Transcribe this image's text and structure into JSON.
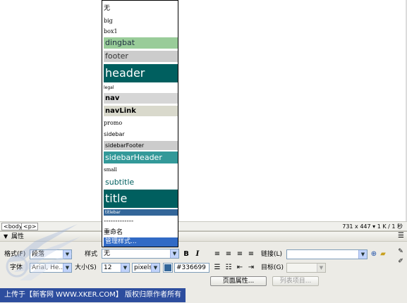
{
  "status_bar": {
    "tags": [
      "<body>",
      "<p>"
    ],
    "size_readout": "731 x 447",
    "download": "1 K / 1 秒"
  },
  "panel": {
    "title": "属性",
    "format_label": "格式(F)",
    "format_value": "段落",
    "font_label": "字体",
    "font_value": "Arial, He...",
    "style_label": "样式",
    "style_value": "无",
    "size_label": "大小(S)",
    "size_value": "12",
    "unit_value": "pixels",
    "color_value": "#336699",
    "bold_label": "B",
    "italic_label": "I",
    "link_label": "链接(L)",
    "link_value": "",
    "target_label": "目标(G)",
    "target_value": "",
    "page_props_button": "页面属性...",
    "list_item_button": "列表项目..."
  },
  "footer": {
    "credit": "上传于【新客网 WWW.XKER.COM】 版权归原作者所有"
  },
  "dropdown": {
    "items": [
      {
        "label": "无"
      },
      {
        "label": "big"
      },
      {
        "label": "box1"
      },
      {
        "label": "dingbat"
      },
      {
        "label": "footer"
      },
      {
        "label": "header"
      },
      {
        "label": "legal"
      },
      {
        "label": "nav"
      },
      {
        "label": "navLink"
      },
      {
        "label": "promo"
      },
      {
        "label": "sidebar"
      },
      {
        "label": "sidebarFooter"
      },
      {
        "label": "sidebarHeader"
      },
      {
        "label": "small"
      },
      {
        "label": "subtitle"
      },
      {
        "label": "title"
      },
      {
        "label": "titlebar"
      },
      {
        "label": "-------------"
      },
      {
        "label": "重命名"
      },
      {
        "label": "管理样式..."
      }
    ]
  },
  "colors": {
    "accent": "#316ac5",
    "teal_dark": "#005f5f",
    "teal": "#339999",
    "green_light": "#99cc99",
    "gray_light": "#cccccc",
    "tan_light": "#d9d9cc",
    "swatch": "#336699"
  }
}
